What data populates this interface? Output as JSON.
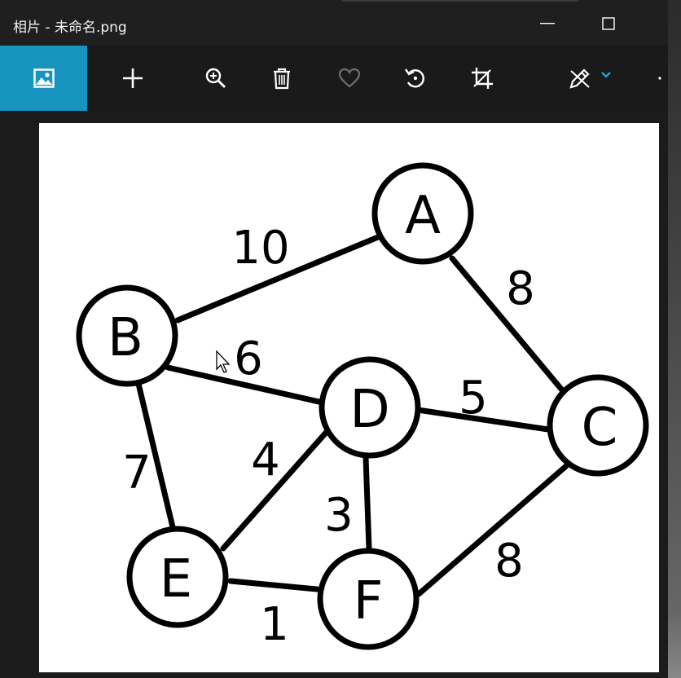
{
  "window": {
    "title": "相片 - 未命名.png"
  },
  "toolbar": {
    "items": [
      {
        "name": "view-image",
        "icon": "image-icon",
        "active": true
      },
      {
        "name": "add",
        "icon": "plus-icon"
      },
      {
        "name": "zoom",
        "icon": "zoom-in-icon"
      },
      {
        "name": "delete",
        "icon": "trash-icon"
      },
      {
        "name": "favorite",
        "icon": "heart-icon"
      },
      {
        "name": "rotate",
        "icon": "rotate-icon"
      },
      {
        "name": "crop",
        "icon": "crop-icon"
      },
      {
        "name": "edit",
        "icon": "pen-draw-icon"
      }
    ],
    "accent": "#1795c0"
  },
  "graph": {
    "nodes": [
      "A",
      "B",
      "C",
      "D",
      "E",
      "F"
    ],
    "edges": [
      {
        "from": "B",
        "to": "A",
        "weight": "10"
      },
      {
        "from": "A",
        "to": "C",
        "weight": "8"
      },
      {
        "from": "B",
        "to": "D",
        "weight": "6"
      },
      {
        "from": "D",
        "to": "C",
        "weight": "5"
      },
      {
        "from": "B",
        "to": "E",
        "weight": "7"
      },
      {
        "from": "E",
        "to": "D",
        "weight": "4"
      },
      {
        "from": "D",
        "to": "F",
        "weight": "3"
      },
      {
        "from": "F",
        "to": "C",
        "weight": "8"
      },
      {
        "from": "E",
        "to": "F",
        "weight": "1"
      }
    ]
  }
}
